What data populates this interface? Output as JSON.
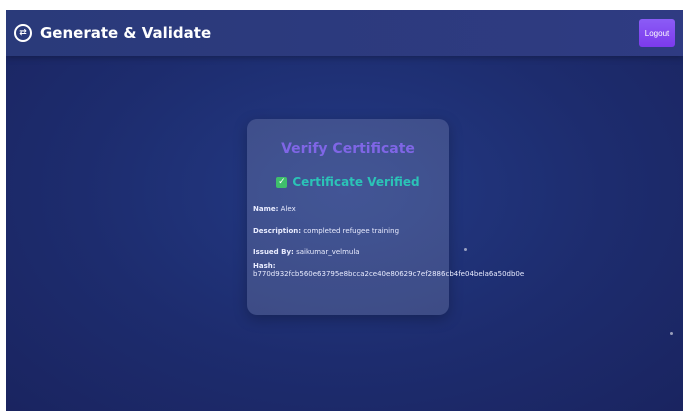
{
  "header": {
    "title": "Generate & Validate",
    "logout_label": "Logout"
  },
  "card": {
    "title": "Verify Certificate",
    "status": "Certificate Verified",
    "fields": {
      "name_label": "Name:",
      "name_value": "Alex",
      "description_label": "Description:",
      "description_value": "completed refugee training",
      "issued_by_label": "Issued By:",
      "issued_by_value": "saikumar_velmula",
      "hash_label": "Hash:",
      "hash_value": "b770d932fcb560e63795e8bcca2ce40e80629c7ef2886cb4fe04bela6a50db0e"
    }
  },
  "colors": {
    "accent": "#7c3aed",
    "status": "#2bc3b7",
    "background": "#1d2c6e"
  }
}
